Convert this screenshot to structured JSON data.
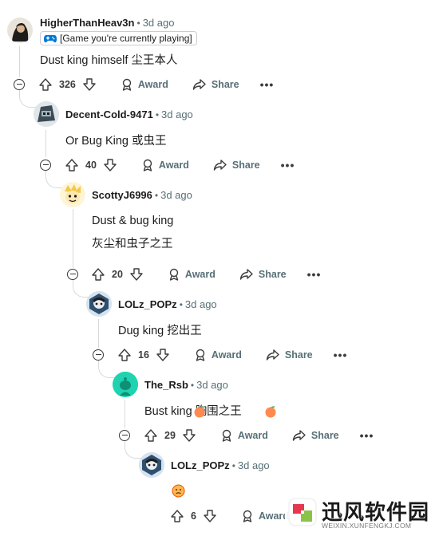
{
  "comments": [
    {
      "username": "HigherThanHeav3n",
      "time": "3d ago",
      "flair": "[Game you're currently playing]",
      "lines": [
        "Dust king himself   尘王本人"
      ],
      "score": "326",
      "award_label": "Award",
      "share_label": "Share",
      "avatar_color": "#1c1c1c"
    },
    {
      "username": "Decent-Cold-9471",
      "time": "3d ago",
      "lines": [
        "Or Bug King   或虫王"
      ],
      "score": "40",
      "award_label": "Award",
      "share_label": "Share",
      "avatar_color": "#3b4a55"
    },
    {
      "username": "ScottyJ6996",
      "time": "3d ago",
      "lines": [
        "Dust & bug king",
        "灰尘和虫子之王"
      ],
      "score": "20",
      "award_label": "Award",
      "share_label": "Share",
      "avatar_color": "#f2c94c"
    },
    {
      "username": "LOLz_POPz",
      "time": "3d ago",
      "lines": [
        "Dug king   挖出王"
      ],
      "score": "16",
      "award_label": "Award",
      "share_label": "Share",
      "avatar_color": "#2f4f6f"
    },
    {
      "username": "The_Rsb",
      "time": "3d ago",
      "lines": [
        "Bust king   胸围之王"
      ],
      "score": "29",
      "award_label": "Award",
      "share_label": "Share",
      "avatar_color": "#1fd3b0"
    },
    {
      "username": "LOLz_POPz",
      "time": "3d ago",
      "lines": [
        ""
      ],
      "score": "6",
      "award_label": "Award",
      "share_label": "Share",
      "avatar_color": "#2f4f6f"
    }
  ],
  "watermark": {
    "title": "迅风软件园",
    "subtitle": "WEIXIN.XUNFENGKJ.COM"
  },
  "colors": {
    "meta_gray": "#576f76",
    "thread_line": "#d6d9dc",
    "flair_icon": "#0079d3",
    "peach": "#ff7043"
  }
}
